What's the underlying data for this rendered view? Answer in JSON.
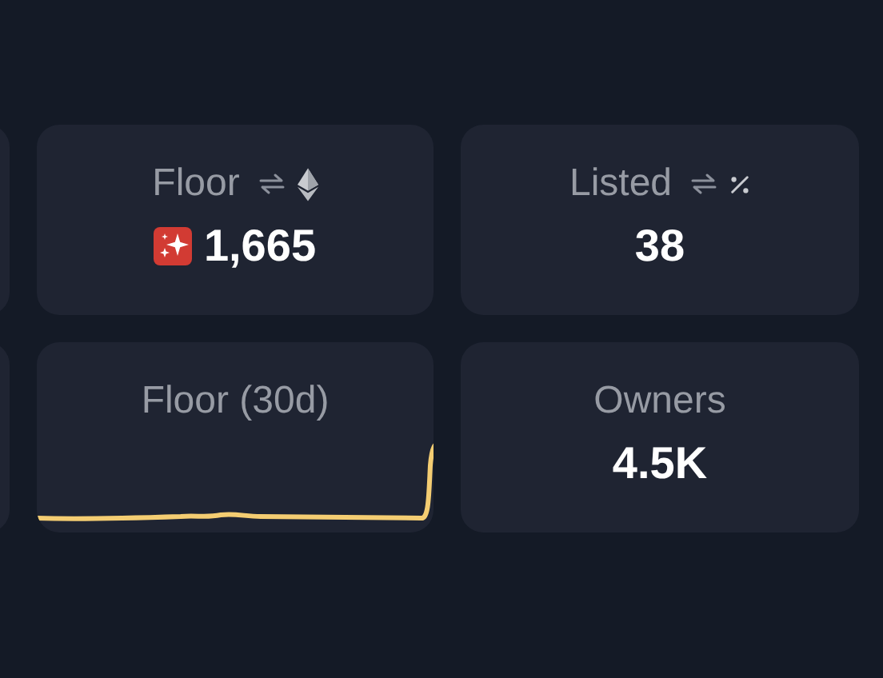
{
  "cards": [
    {
      "kind": "price",
      "label": "Floor",
      "value": "1,665"
    },
    {
      "kind": "count",
      "label": "Listed",
      "value": "38"
    },
    {
      "kind": "chart",
      "label": "Floor (30d)"
    },
    {
      "kind": "plain",
      "label": "Owners",
      "value": "4.5K"
    }
  ]
}
